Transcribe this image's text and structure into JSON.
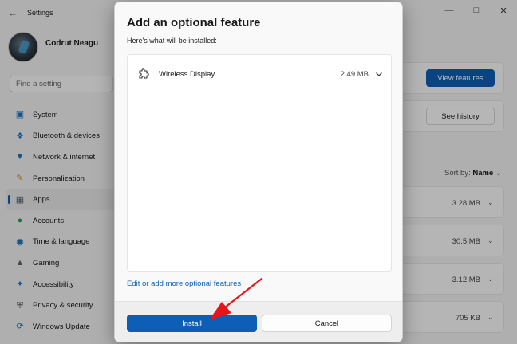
{
  "window": {
    "app_title": "Settings",
    "user_name": "Codrut Neagu",
    "search_placeholder": "Find a setting"
  },
  "sidebar": {
    "items": [
      {
        "label": "System",
        "icon": "system-icon"
      },
      {
        "label": "Bluetooth & devices",
        "icon": "bluetooth-icon"
      },
      {
        "label": "Network & internet",
        "icon": "wifi-icon"
      },
      {
        "label": "Personalization",
        "icon": "brush-icon"
      },
      {
        "label": "Apps",
        "icon": "apps-icon",
        "active": true
      },
      {
        "label": "Accounts",
        "icon": "person-icon"
      },
      {
        "label": "Time & language",
        "icon": "globe-icon"
      },
      {
        "label": "Gaming",
        "icon": "gamepad-icon"
      },
      {
        "label": "Accessibility",
        "icon": "accessibility-icon"
      },
      {
        "label": "Privacy & security",
        "icon": "shield-icon"
      },
      {
        "label": "Windows Update",
        "icon": "update-icon"
      }
    ]
  },
  "main": {
    "view_features_label": "View features",
    "see_history_label": "See history",
    "sort_label": "Sort by:",
    "sort_value": "Name",
    "rows": [
      {
        "size": "3.28 MB"
      },
      {
        "size": "30.5 MB"
      },
      {
        "size": "3.12 MB"
      },
      {
        "size": "705 KB"
      }
    ]
  },
  "dialog": {
    "title": "Add an optional feature",
    "subtitle": "Here's what will be installed:",
    "feature": {
      "name": "Wireless Display",
      "size": "2.49 MB",
      "icon": "puzzle-icon"
    },
    "link_label": "Edit or add more optional features",
    "install_label": "Install",
    "cancel_label": "Cancel"
  },
  "colors": {
    "accent": "#0f5eb5",
    "annotation_arrow": "#e8141c"
  }
}
